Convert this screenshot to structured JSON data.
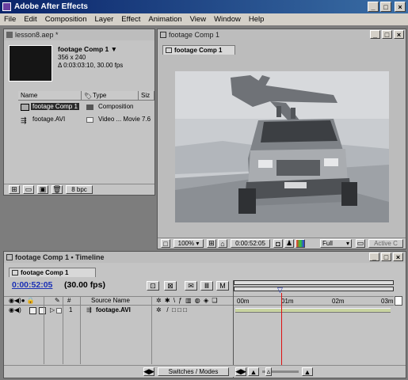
{
  "app": {
    "title": "Adobe After Effects",
    "menu": [
      "File",
      "Edit",
      "Composition",
      "Layer",
      "Effect",
      "Animation",
      "View",
      "Window",
      "Help"
    ]
  },
  "project": {
    "title": "lesson8.aep *",
    "comp_name": "footage Comp 1",
    "dimensions": "356 x 240",
    "duration": "Δ 0:03:03:10, 30.00 fps",
    "columns": {
      "name": "Name",
      "type": "Type",
      "size": "Siz"
    },
    "items": [
      {
        "name": "footage Comp 1",
        "type": "Composition",
        "size": ""
      },
      {
        "name": "footage.AVI",
        "type": "Video ... Movie",
        "size": "7.6"
      }
    ],
    "bpc": "8 bpc"
  },
  "comp_window": {
    "title": "footage Comp 1",
    "tab": "footage Comp 1",
    "zoom": "100%",
    "timecode": "0:00:52:05",
    "resolution": "Full",
    "view": "Active C"
  },
  "timeline": {
    "title": "footage Comp 1 • Timeline",
    "tab": "footage Comp 1",
    "current_time": "0:00:52:05",
    "fps": "(30.00 fps)",
    "col_num": "#",
    "col_source": "Source Name",
    "ruler": [
      "00m",
      "01m",
      "02m",
      "03m"
    ],
    "layers": [
      {
        "num": "1",
        "name": "footage.AVI"
      }
    ],
    "switches_label": "Switches / Modes"
  }
}
